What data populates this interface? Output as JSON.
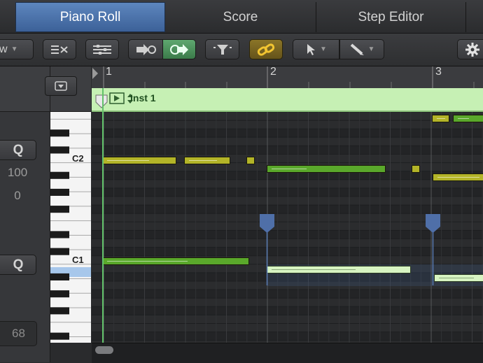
{
  "tabs": [
    {
      "label": "Piano Roll",
      "active": true
    },
    {
      "label": "Score",
      "active": false
    },
    {
      "label": "Step Editor",
      "active": false
    }
  ],
  "toolbar": {
    "view_menu_label": "w",
    "left_tool": "pointer-tool",
    "right_tool": "pencil-tool"
  },
  "inspector": {
    "quantize_label": "Q",
    "quantize_label_2": "Q",
    "value_1": "100",
    "value_2": "0",
    "value_3": "68"
  },
  "ruler": {
    "bars": [
      "1",
      "2",
      "3"
    ]
  },
  "region": {
    "name": "Inst 1"
  },
  "keyboard": {
    "labels": [
      "C2",
      "C1"
    ]
  },
  "colors": {
    "tab_active": "#4a72aa",
    "region": "#c6f0b4",
    "note_green": "#5aa82b",
    "note_yellow": "#b3b428",
    "note_selected": "#d7f4c2",
    "playhead_marker": "#4f6fa8"
  }
}
